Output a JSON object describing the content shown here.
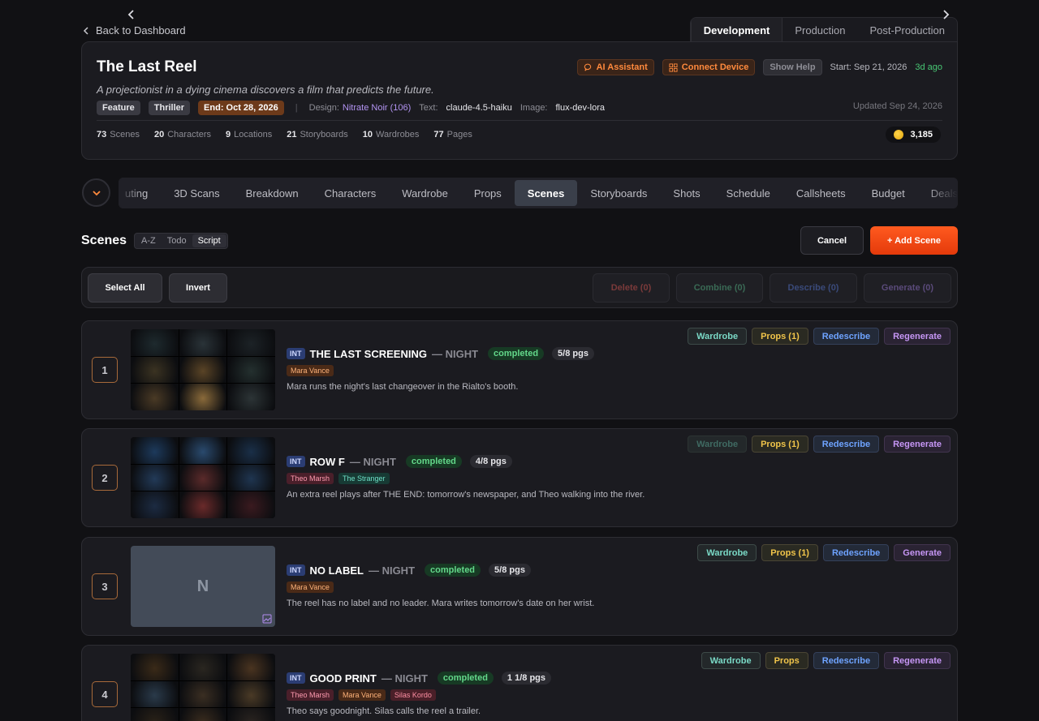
{
  "nav": {
    "back_label": "Back to Dashboard",
    "phases": [
      "Development",
      "Production",
      "Post-Production"
    ],
    "active_phase": "Development"
  },
  "project": {
    "title": "The Last Reel",
    "tagline": "A projectionist in a dying cinema discovers a film that predicts the future.",
    "tags": [
      "Feature",
      "Thriller"
    ],
    "end_date": "End: Oct 28, 2026",
    "design_label": "Design:",
    "design_value": "Nitrate Noir (106)",
    "text_label": "Text:",
    "text_value": "claude-4.5-haiku",
    "image_label": "Image:",
    "image_value": "flux-dev-lora",
    "updated": "Updated Sep 24, 2026",
    "ai_assistant": "AI Assistant",
    "connect_device": "Connect Device",
    "show_help": "Show Help",
    "start": "Start: Sep 21, 2026",
    "ago": "3d ago",
    "credits": "3,185",
    "stats": [
      {
        "num": "73",
        "label": "Scenes"
      },
      {
        "num": "20",
        "label": "Characters"
      },
      {
        "num": "9",
        "label": "Locations"
      },
      {
        "num": "21",
        "label": "Storyboards"
      },
      {
        "num": "10",
        "label": "Wardrobes"
      },
      {
        "num": "77",
        "label": "Pages"
      }
    ]
  },
  "tabs": [
    "uting",
    "3D Scans",
    "Breakdown",
    "Characters",
    "Wardrobe",
    "Props",
    "Scenes",
    "Storyboards",
    "Shots",
    "Schedule",
    "Callsheets",
    "Budget",
    "Deals"
  ],
  "active_tab": "Scenes",
  "scenes_header": {
    "title": "Scenes",
    "sort_options": [
      "A-Z",
      "Todo",
      "Script"
    ],
    "active_sort": "Script",
    "cancel": "Cancel",
    "add": "+ Add Scene"
  },
  "toolbar": {
    "select_all": "Select All",
    "invert": "Invert",
    "delete": "Delete (0)",
    "combine": "Combine (0)",
    "describe": "Describe (0)",
    "generate": "Generate (0)",
    "colors": {
      "delete": "#7a3a3a",
      "combine": "#3a6a55",
      "describe": "#3a4a7a",
      "generate": "#5a4a7a"
    }
  },
  "scenes": [
    {
      "number": "1",
      "int": "INT",
      "slug": "THE LAST SCREENING",
      "tod": "— NIGHT",
      "status": "completed",
      "pages": "5/8 pgs",
      "characters": [
        {
          "name": "Mara Vance",
          "kind": "mara"
        }
      ],
      "description": "Mara runs the night's last changeover in the Rialto's booth.",
      "actions": [
        "Wardrobe",
        "Props (1)",
        "Redescribe",
        "Regenerate"
      ],
      "wardrobe_dim": false,
      "thumb": "grid-dark"
    },
    {
      "number": "2",
      "int": "INT",
      "slug": "ROW F",
      "tod": "— NIGHT",
      "status": "completed",
      "pages": "4/8 pgs",
      "characters": [
        {
          "name": "Theo Marsh",
          "kind": "theo"
        },
        {
          "name": "The Stranger",
          "kind": "stranger"
        }
      ],
      "description": "An extra reel plays after THE END: tomorrow's newspaper, and Theo walking into the river.",
      "actions": [
        "Wardrobe",
        "Props (1)",
        "Redescribe",
        "Regenerate"
      ],
      "wardrobe_dim": true,
      "thumb": "grid-blue"
    },
    {
      "number": "3",
      "int": "INT",
      "slug": "NO LABEL",
      "tod": "— NIGHT",
      "status": "completed",
      "pages": "5/8 pgs",
      "characters": [
        {
          "name": "Mara Vance",
          "kind": "mara"
        }
      ],
      "description": "The reel has no label and no leader. Mara writes tomorrow's date on her wrist.",
      "actions": [
        "Wardrobe",
        "Props (1)",
        "Redescribe",
        "Generate"
      ],
      "wardrobe_dim": false,
      "thumb": "placeholder",
      "placeholder_letter": "N"
    },
    {
      "number": "4",
      "int": "INT",
      "slug": "GOOD PRINT",
      "tod": "— NIGHT",
      "status": "completed",
      "pages": "1 1/8 pgs",
      "characters": [
        {
          "name": "Theo Marsh",
          "kind": "theo"
        },
        {
          "name": "Mara Vance",
          "kind": "mara"
        },
        {
          "name": "Silas Kordo",
          "kind": "silas"
        }
      ],
      "description": "Theo says goodnight. Silas calls the reel a trailer.",
      "actions": [
        "Wardrobe",
        "Props",
        "Redescribe",
        "Regenerate"
      ],
      "wardrobe_dim": false,
      "thumb": "grid-warm"
    }
  ]
}
